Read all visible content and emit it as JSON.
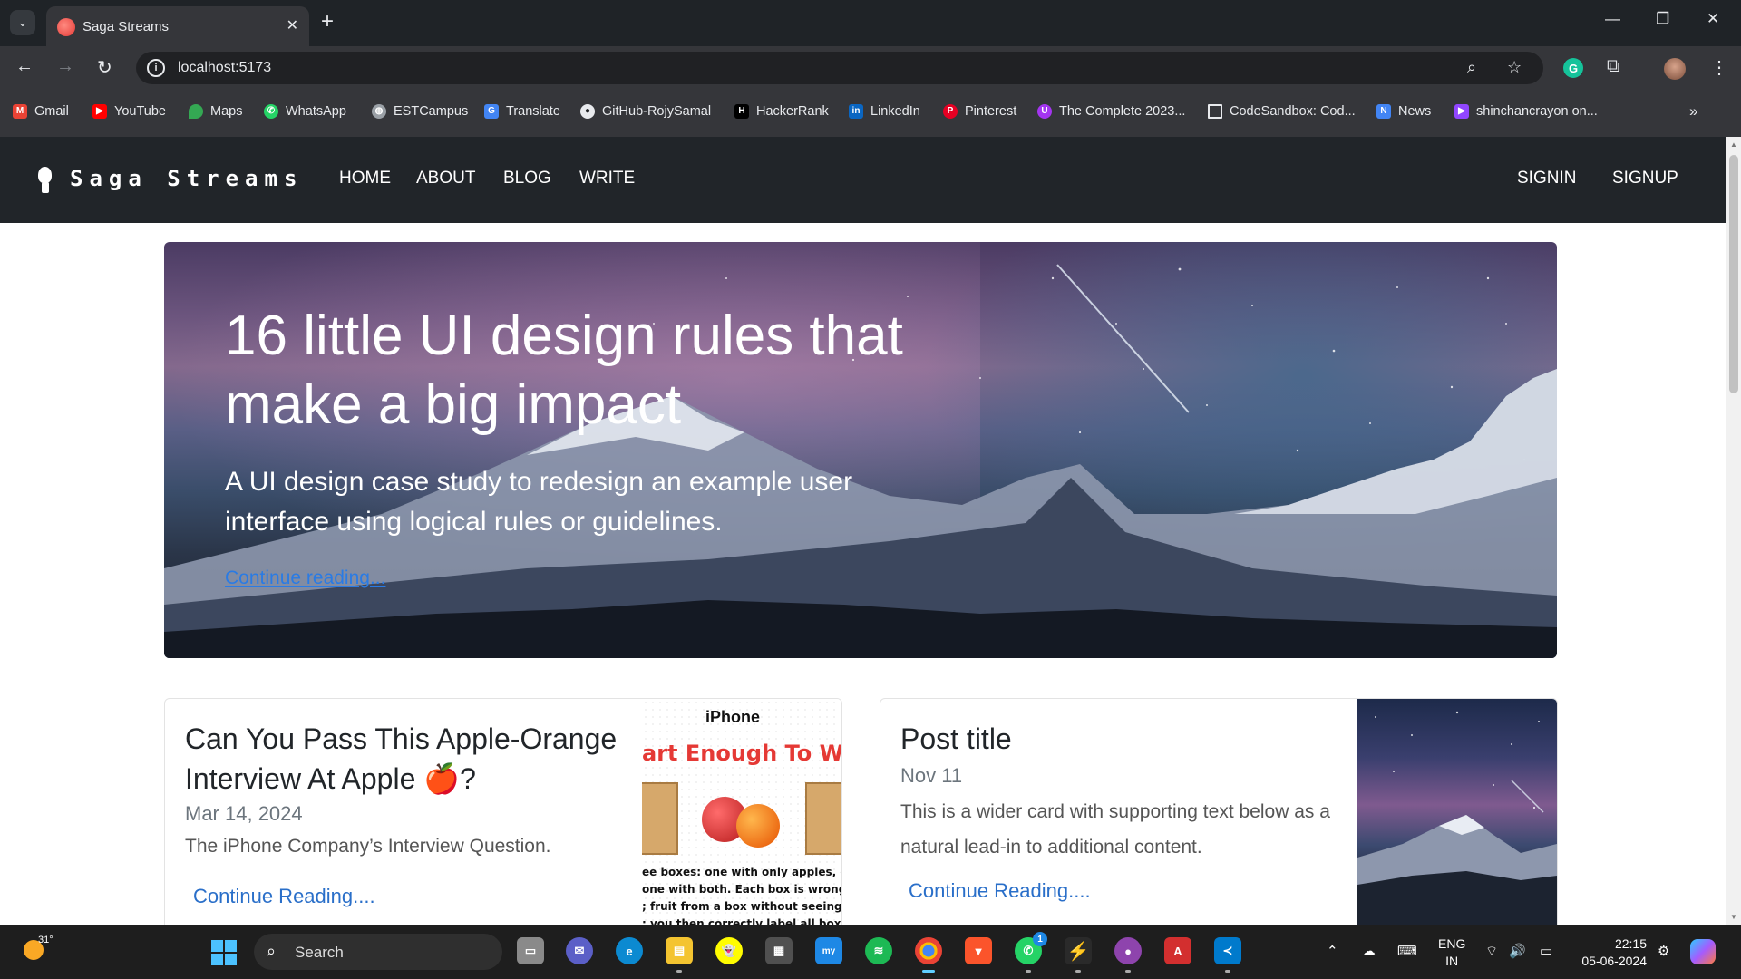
{
  "browser": {
    "tab_title": "Saga Streams",
    "url": "localhost:5173",
    "bookmarks": [
      {
        "label": "Gmail",
        "color": "#ea4335"
      },
      {
        "label": "YouTube",
        "color": "#ff0000"
      },
      {
        "label": "Maps",
        "color": "#34a853"
      },
      {
        "label": "WhatsApp",
        "color": "#25d366"
      },
      {
        "label": "ESTCampus",
        "color": "#9aa0a6"
      },
      {
        "label": "Translate",
        "color": "#4285f4"
      },
      {
        "label": "GitHub-RojySamal",
        "color": "#e8eaed"
      },
      {
        "label": "HackerRank",
        "color": "#000000"
      },
      {
        "label": "LinkedIn",
        "color": "#0a66c2"
      },
      {
        "label": "Pinterest",
        "color": "#e60023"
      },
      {
        "label": "The Complete 2023...",
        "color": "#a435f0"
      },
      {
        "label": "CodeSandbox: Cod...",
        "color": "#35363a"
      },
      {
        "label": "News",
        "color": "#4285f4"
      },
      {
        "label": "shinchancrayon on...",
        "color": "#9146ff"
      }
    ]
  },
  "site": {
    "brand": "Saga Streams",
    "nav": [
      "HOME",
      "ABOUT",
      "BLOG",
      "WRITE"
    ],
    "auth": [
      "SIGNIN",
      "SIGNUP"
    ]
  },
  "hero": {
    "title": "16 little UI design rules that make a big impact",
    "lead": "A UI design case study to redesign an example user interface using logical rules or guidelines.",
    "link": "Continue reading..."
  },
  "cards": [
    {
      "title": "Can You Pass This Apple-Orange Interview At Apple 🍎?",
      "date": "Mar 14, 2024",
      "text": "The iPhone Company’s Interview Question.",
      "link": "Continue Reading....",
      "image": {
        "brand": " iPhone",
        "headline": "art Enough To Wor",
        "fine_print": [
          "ee boxes: one with only apples, c",
          "one with both. Each box is wrong",
          "; fruit from a box without seeing",
          "; you then correctly label all box"
        ]
      }
    },
    {
      "title": "Post title",
      "date": "Nov 11",
      "text": "This is a wider card with supporting text below as a natural lead-in to additional content.",
      "link": "Continue Reading...."
    }
  ],
  "taskbar": {
    "weather_temp": "31°",
    "search_label": "Search",
    "whatsapp_badge": "1",
    "lang_1": "ENG",
    "lang_2": "IN",
    "time": "22:15",
    "date": "05-06-2024"
  }
}
